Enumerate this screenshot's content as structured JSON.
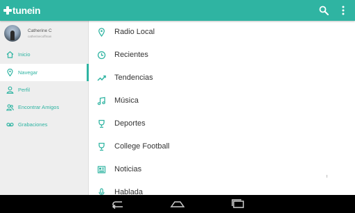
{
  "app": {
    "logo_text": "tunein"
  },
  "topbar": {
    "search_icon": "search-icon",
    "more_icon": "more-vert-icon"
  },
  "sidebar": {
    "profile": {
      "name": "Catherine C",
      "handle": "catherinecoffman"
    },
    "items": [
      {
        "label": "Inicio",
        "icon": "home-icon"
      },
      {
        "label": "Navegar",
        "icon": "location-pin-icon",
        "active": true
      },
      {
        "label": "Perfil",
        "icon": "person-icon"
      },
      {
        "label": "Encontrar Amigos",
        "icon": "people-icon"
      },
      {
        "label": "Grabaciones",
        "icon": "voicemail-icon"
      }
    ]
  },
  "browse": {
    "items": [
      {
        "label": "Radio Local",
        "icon": "location-pin-icon"
      },
      {
        "label": "Recientes",
        "icon": "clock-icon"
      },
      {
        "label": "Tendencias",
        "icon": "trending-icon"
      },
      {
        "label": "Música",
        "icon": "music-note-icon"
      },
      {
        "label": "Deportes",
        "icon": "trophy-icon"
      },
      {
        "label": "College Football",
        "icon": "trophy-icon"
      },
      {
        "label": "Noticias",
        "icon": "newspaper-icon"
      },
      {
        "label": "Hablada",
        "icon": "microphone-icon"
      }
    ]
  },
  "system_nav": {
    "back_icon": "back-icon",
    "home_icon": "home-button-icon",
    "recents_icon": "recents-icon"
  },
  "colors": {
    "accent": "#2fb4a2",
    "sidebar_bg": "#eeeeee",
    "text": "#333333"
  }
}
